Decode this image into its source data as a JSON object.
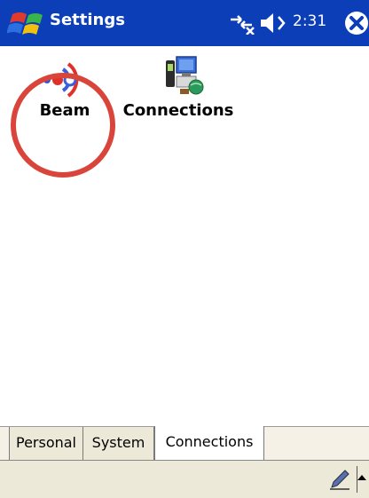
{
  "titlebar": {
    "title": "Settings",
    "time": "2:31",
    "start_icon": "windows-flag-icon",
    "connectivity_icon": "connectivity-icon",
    "volume_icon": "speaker-icon",
    "close_icon": "close-icon"
  },
  "apps": [
    {
      "label": "Beam",
      "icon": "beam-icon"
    },
    {
      "label": "Connections",
      "icon": "connections-icon"
    }
  ],
  "tabs": [
    {
      "label": "Personal"
    },
    {
      "label": "System"
    },
    {
      "label": "Connections",
      "active": true
    }
  ],
  "commandbar": {
    "input_icon": "pen-icon",
    "sip_icon": "sip-up-arrow-icon"
  },
  "colors": {
    "titlebar": "#0c3fb7",
    "highlight": "#d9453b",
    "tab_bg": "#ece9d8"
  }
}
